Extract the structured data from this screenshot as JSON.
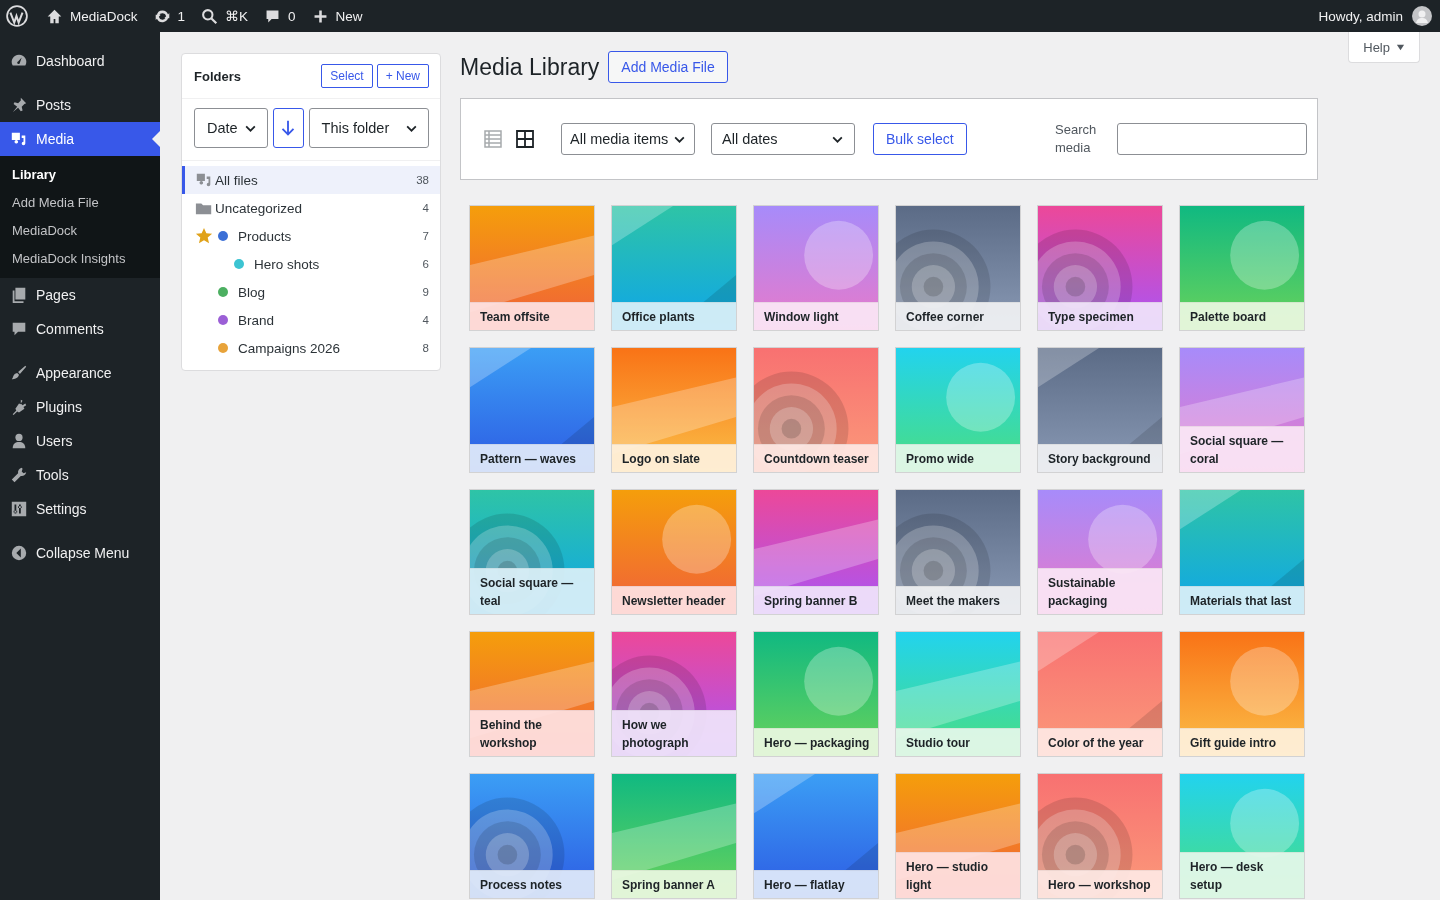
{
  "admin_bar": {
    "site": "MediaDock",
    "updates": "1",
    "search_shortcut": "⌘K",
    "comments": "0",
    "new_label": "New",
    "greeting": "Howdy, admin"
  },
  "sidebar": {
    "groups": [
      {
        "items": [
          {
            "label": "Dashboard",
            "kind": "dashboard",
            "selected": false
          }
        ]
      },
      {
        "items": [
          {
            "label": "Posts",
            "kind": "posts",
            "selected": false
          },
          {
            "label": "Media",
            "kind": "media",
            "selected": true,
            "submenu": [
              {
                "label": "Library",
                "selected": true
              },
              {
                "label": "Add Media File",
                "selected": false
              },
              {
                "label": "MediaDock",
                "selected": false
              },
              {
                "label": "MediaDock Insights",
                "selected": false
              }
            ]
          },
          {
            "label": "Pages",
            "kind": "pages",
            "selected": false
          },
          {
            "label": "Comments",
            "kind": "comments",
            "selected": false
          }
        ]
      },
      {
        "items": [
          {
            "label": "Appearance",
            "kind": "appearance",
            "selected": false
          },
          {
            "label": "Plugins",
            "kind": "plugins",
            "selected": false
          },
          {
            "label": "Users",
            "kind": "users",
            "selected": false
          },
          {
            "label": "Tools",
            "kind": "tools",
            "selected": false
          },
          {
            "label": "Settings",
            "kind": "settings",
            "selected": false
          }
        ]
      }
    ],
    "collapse_label": "Collapse Menu"
  },
  "help": "Help",
  "folders": {
    "title": "Folders",
    "select_button": "Select",
    "new_button": "+ New",
    "sort_field": "Date",
    "sort_descending": true,
    "scope": "This folder",
    "items": [
      {
        "label": "All files",
        "count": "38",
        "kind": "all",
        "selected": true
      },
      {
        "label": "Uncategorized",
        "count": "4",
        "kind": "uncategorized",
        "selected": false
      },
      {
        "label": "Products",
        "count": "7",
        "kind": "folder",
        "color": "#3b6fd6",
        "starred": true,
        "selected": false,
        "children": [
          {
            "label": "Hero shots",
            "count": "6",
            "kind": "folder",
            "color": "#3cc4d2",
            "starred": false,
            "selected": false
          }
        ]
      },
      {
        "label": "Blog",
        "count": "9",
        "kind": "folder",
        "color": "#4caf61",
        "starred": false,
        "selected": false
      },
      {
        "label": "Brand",
        "count": "4",
        "kind": "folder",
        "color": "#9b5fd6",
        "starred": false,
        "selected": false
      },
      {
        "label": "Campaigns 2026",
        "count": "8",
        "kind": "folder",
        "color": "#e8a33a",
        "starred": false,
        "selected": false
      }
    ]
  },
  "page_title": "Media Library",
  "add_button": "Add Media File",
  "toolbar": {
    "views": [
      {
        "kind": "list",
        "selected": false
      },
      {
        "kind": "grid",
        "selected": true
      }
    ],
    "type_filter": "All media items",
    "date_filter": "All dates",
    "bulk_button": "Bulk select",
    "search_label": "Search media"
  },
  "media": [
    {
      "title": "Team offsite"
    },
    {
      "title": "Office plants"
    },
    {
      "title": "Window light"
    },
    {
      "title": "Coffee corner"
    },
    {
      "title": "Type specimen"
    },
    {
      "title": "Palette board"
    },
    {
      "title": "Pattern — waves"
    },
    {
      "title": "Logo on slate"
    },
    {
      "title": "Countdown teaser"
    },
    {
      "title": "Promo wide"
    },
    {
      "title": "Story background"
    },
    {
      "title": "Social square — coral"
    },
    {
      "title": "Social square — teal"
    },
    {
      "title": "Newsletter header"
    },
    {
      "title": "Spring banner B"
    },
    {
      "title": "Meet the makers"
    },
    {
      "title": "Sustainable packaging"
    },
    {
      "title": "Materials that last"
    },
    {
      "title": "Behind the workshop"
    },
    {
      "title": "How we photograph"
    },
    {
      "title": "Hero — packaging"
    },
    {
      "title": "Studio tour"
    },
    {
      "title": "Color of the year"
    },
    {
      "title": "Gift guide intro"
    },
    {
      "title": "Process notes"
    },
    {
      "title": "Spring banner A"
    },
    {
      "title": "Hero — flatlay"
    },
    {
      "title": "Hero — studio light"
    },
    {
      "title": "Hero — workshop"
    },
    {
      "title": "Hero — desk setup"
    }
  ]
}
